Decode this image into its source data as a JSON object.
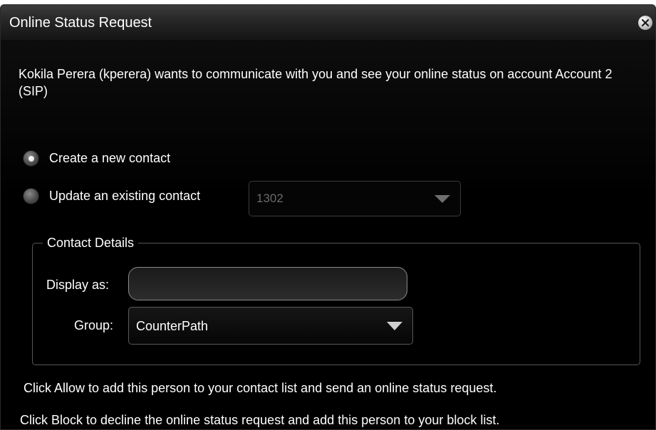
{
  "dialog": {
    "title": "Online Status Request",
    "close_icon": "close-icon"
  },
  "message": "Kokila Perera (kperera)  wants to communicate with you and see your online status on account Account 2 (SIP)",
  "options": {
    "create_new": {
      "label": "Create a new contact",
      "selected": true
    },
    "update_existing": {
      "label": "Update an existing contact",
      "selected": false,
      "existing_value": "1302",
      "enabled": false
    }
  },
  "contact_details": {
    "legend": "Contact Details",
    "display_as_label": "Display as:",
    "display_as_value": "",
    "group_label": "Group:",
    "group_value": "CounterPath"
  },
  "help": {
    "allow_text": "Click Allow to add this person to your contact list and send an online status request.",
    "block_text": "Click Block to decline the online status request and add this person to your block list."
  },
  "colors": {
    "background": "#000000",
    "text": "#ffffff",
    "disabled_text": "#6a6a6a"
  }
}
